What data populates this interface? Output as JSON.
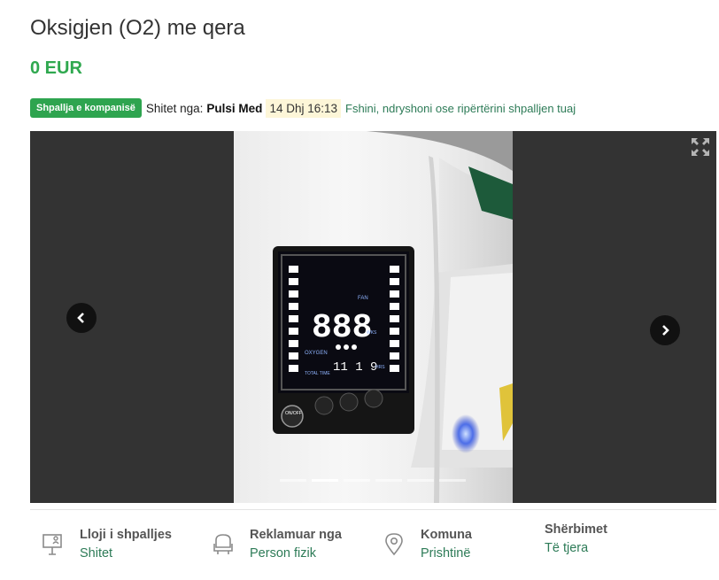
{
  "listing": {
    "title": "Oksigjen (O2) me qera",
    "price": "0 EUR",
    "badge": "Shpallja e kompanisë",
    "seller_prefix": "Shitet nga:",
    "seller_name": "Pulsi Med",
    "date": "14 Dhj 16:13",
    "manage_link": "Fshini, ndryshoni ose ripërtërini shpalljen tuaj"
  },
  "gallery": {
    "device_display": {
      "fan_label": "FAN",
      "digits": "888",
      "unit": "WKS",
      "oxygen_label": "OXYGEN",
      "total_time_label": "TOTAL TIME",
      "hours": "11 1 9",
      "hours_unit": "HRS",
      "power_label": "ON/OFF"
    },
    "slide_count": 6,
    "active_slide": 2
  },
  "details": [
    {
      "label": "Lloji i shpalljes",
      "value": "Shitet",
      "icon": "sign-icon"
    },
    {
      "label": "Reklamuar nga",
      "value": "Person fizik",
      "icon": "person-chair-icon"
    },
    {
      "label": "Komuna",
      "value": "Prishtinë",
      "icon": "location-pin-icon"
    },
    {
      "label": "Shërbimet",
      "value": "Të tjera",
      "icon": ""
    }
  ]
}
